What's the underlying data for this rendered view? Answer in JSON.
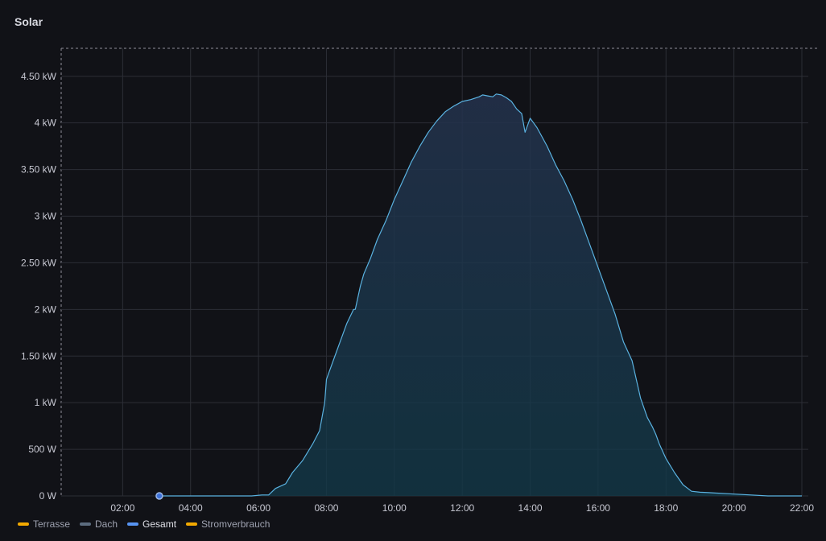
{
  "panel": {
    "title": "Solar"
  },
  "chart_data": {
    "type": "area",
    "title": "Solar",
    "xlim": [
      0.0,
      22.0
    ],
    "ylim": [
      0,
      4800
    ],
    "x_ticks": [
      {
        "value": 2,
        "label": "02:00"
      },
      {
        "value": 4,
        "label": "04:00"
      },
      {
        "value": 6,
        "label": "06:00"
      },
      {
        "value": 8,
        "label": "08:00"
      },
      {
        "value": 10,
        "label": "10:00"
      },
      {
        "value": 12,
        "label": "12:00"
      },
      {
        "value": 14,
        "label": "14:00"
      },
      {
        "value": 16,
        "label": "16:00"
      },
      {
        "value": 18,
        "label": "18:00"
      },
      {
        "value": 20,
        "label": "20:00"
      },
      {
        "value": 22,
        "label": "22:00"
      }
    ],
    "y_ticks": [
      {
        "value": 0,
        "label": "0 W"
      },
      {
        "value": 500,
        "label": "500 W"
      },
      {
        "value": 1000,
        "label": "1 kW"
      },
      {
        "value": 1500,
        "label": "1.50 kW"
      },
      {
        "value": 2000,
        "label": "2 kW"
      },
      {
        "value": 2500,
        "label": "2.50 kW"
      },
      {
        "value": 3000,
        "label": "3 kW"
      },
      {
        "value": 3500,
        "label": "3.50 kW"
      },
      {
        "value": 4000,
        "label": "4 kW"
      },
      {
        "value": 4500,
        "label": "4.50 kW"
      }
    ],
    "grid": true,
    "legend": [
      {
        "name": "Terrasse",
        "color": "#f2a900",
        "active": false
      },
      {
        "name": "Dach",
        "color": "#5c6c7f",
        "active": false
      },
      {
        "name": "Gesamt",
        "color": "#5794f2",
        "active": true
      },
      {
        "name": "Stromverbrauch",
        "color": "#f2a900",
        "active": false
      }
    ],
    "series": [
      {
        "name": "Gesamt",
        "color": "#5ab2e0",
        "x": [
          3.08,
          4.0,
          5.0,
          5.8,
          6.1,
          6.3,
          6.5,
          6.8,
          7.0,
          7.3,
          7.6,
          7.8,
          7.95,
          8.0,
          8.2,
          8.4,
          8.6,
          8.8,
          8.85,
          9.0,
          9.1,
          9.3,
          9.5,
          9.75,
          10.0,
          10.25,
          10.5,
          10.75,
          11.0,
          11.25,
          11.5,
          11.75,
          12.0,
          12.25,
          12.5,
          12.6,
          12.75,
          12.9,
          13.0,
          13.15,
          13.3,
          13.45,
          13.6,
          13.75,
          13.85,
          14.0,
          14.1,
          14.2,
          14.35,
          14.5,
          14.75,
          15.0,
          15.25,
          15.5,
          15.75,
          16.0,
          16.25,
          16.5,
          16.75,
          17.0,
          17.25,
          17.45,
          17.6,
          17.7,
          17.8,
          18.0,
          18.25,
          18.5,
          18.75,
          19.0,
          19.25,
          19.5,
          20.0,
          20.5,
          21.0,
          21.5,
          22.0
        ],
        "values": [
          0,
          0,
          0,
          0,
          10,
          10,
          80,
          130,
          250,
          380,
          560,
          700,
          1000,
          1250,
          1450,
          1650,
          1850,
          2000,
          2000,
          2250,
          2380,
          2550,
          2750,
          2950,
          3180,
          3380,
          3580,
          3750,
          3900,
          4020,
          4120,
          4180,
          4230,
          4250,
          4280,
          4300,
          4290,
          4280,
          4310,
          4300,
          4270,
          4230,
          4150,
          4100,
          3900,
          4050,
          4000,
          3950,
          3850,
          3750,
          3550,
          3380,
          3180,
          2950,
          2700,
          2450,
          2200,
          1950,
          1650,
          1450,
          1050,
          840,
          740,
          660,
          560,
          400,
          250,
          120,
          50,
          40,
          35,
          30,
          20,
          10,
          0,
          0,
          0
        ]
      }
    ],
    "marker": {
      "x": 3.08,
      "y": 0
    }
  }
}
